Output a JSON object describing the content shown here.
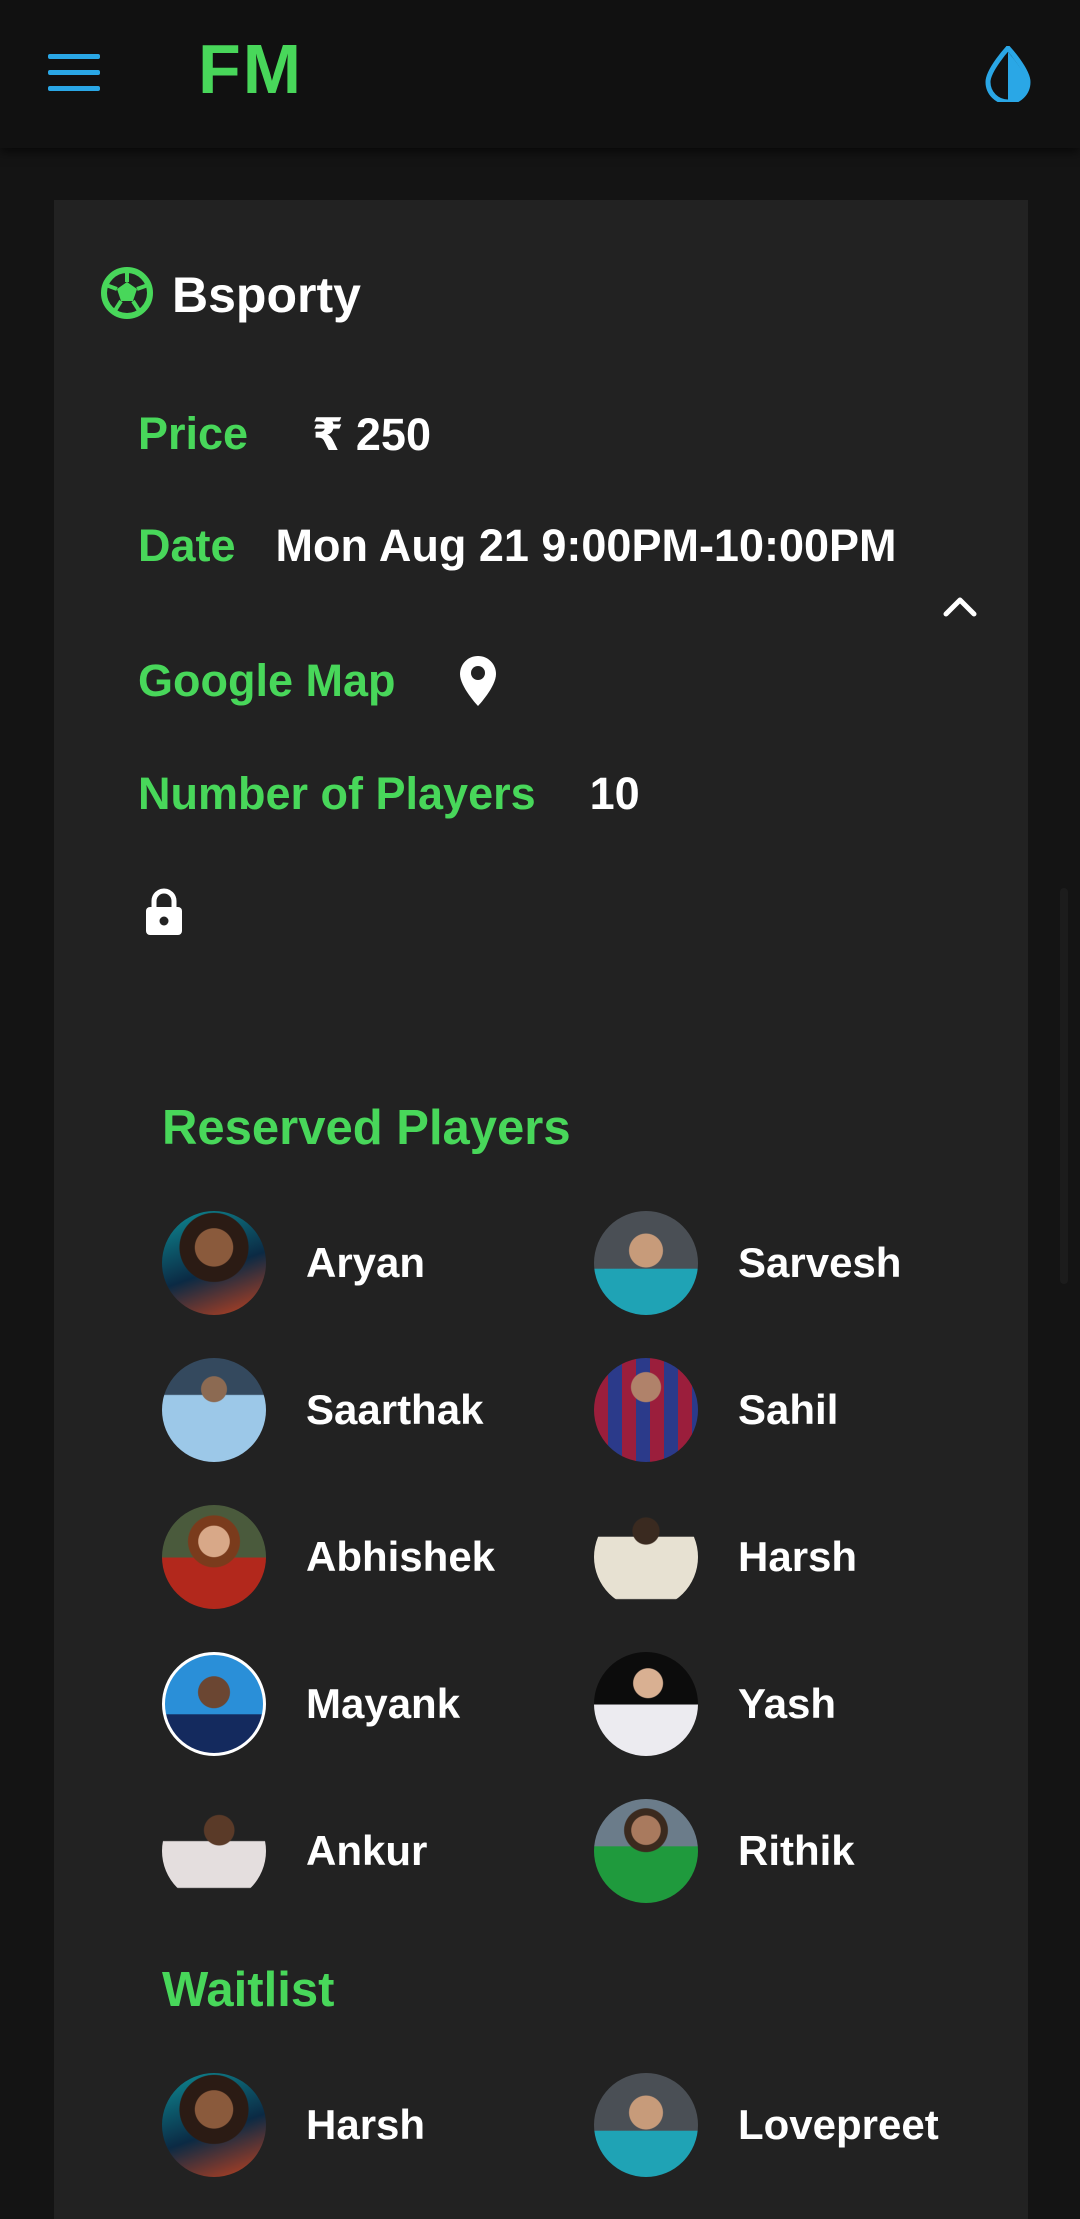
{
  "app": {
    "logo": "FM"
  },
  "header": {
    "menu_icon": "hamburger-menu-icon",
    "theme_icon": "water-drop-icon"
  },
  "venue": {
    "name": "Bsporty",
    "icon": "soccer-ball-icon"
  },
  "details": {
    "price_label": "Price",
    "price_value": "₹ 250",
    "date_label": "Date",
    "date_value": "Mon Aug 21 9:00PM-10:00PM",
    "map_label": "Google Map",
    "map_icon": "map-pin-icon",
    "players_label": "Number of Players",
    "players_value": "10",
    "lock_icon": "lock-icon",
    "collapse_icon": "chevron-up-icon"
  },
  "reserved": {
    "title": "Reserved Players",
    "players": [
      {
        "name": "Aryan"
      },
      {
        "name": "Sarvesh"
      },
      {
        "name": "Saarthak"
      },
      {
        "name": "Sahil"
      },
      {
        "name": "Abhishek"
      },
      {
        "name": "Harsh"
      },
      {
        "name": "Mayank"
      },
      {
        "name": "Yash"
      },
      {
        "name": "Ankur"
      },
      {
        "name": "Rithik"
      }
    ]
  },
  "waitlist": {
    "title": "Waitlist",
    "players": [
      {
        "name": "Harsh"
      },
      {
        "name": "Lovepreet"
      }
    ]
  },
  "colors": {
    "accent": "#48d75a",
    "blue": "#2aa7e6",
    "card": "#222222",
    "background": "#141414"
  }
}
